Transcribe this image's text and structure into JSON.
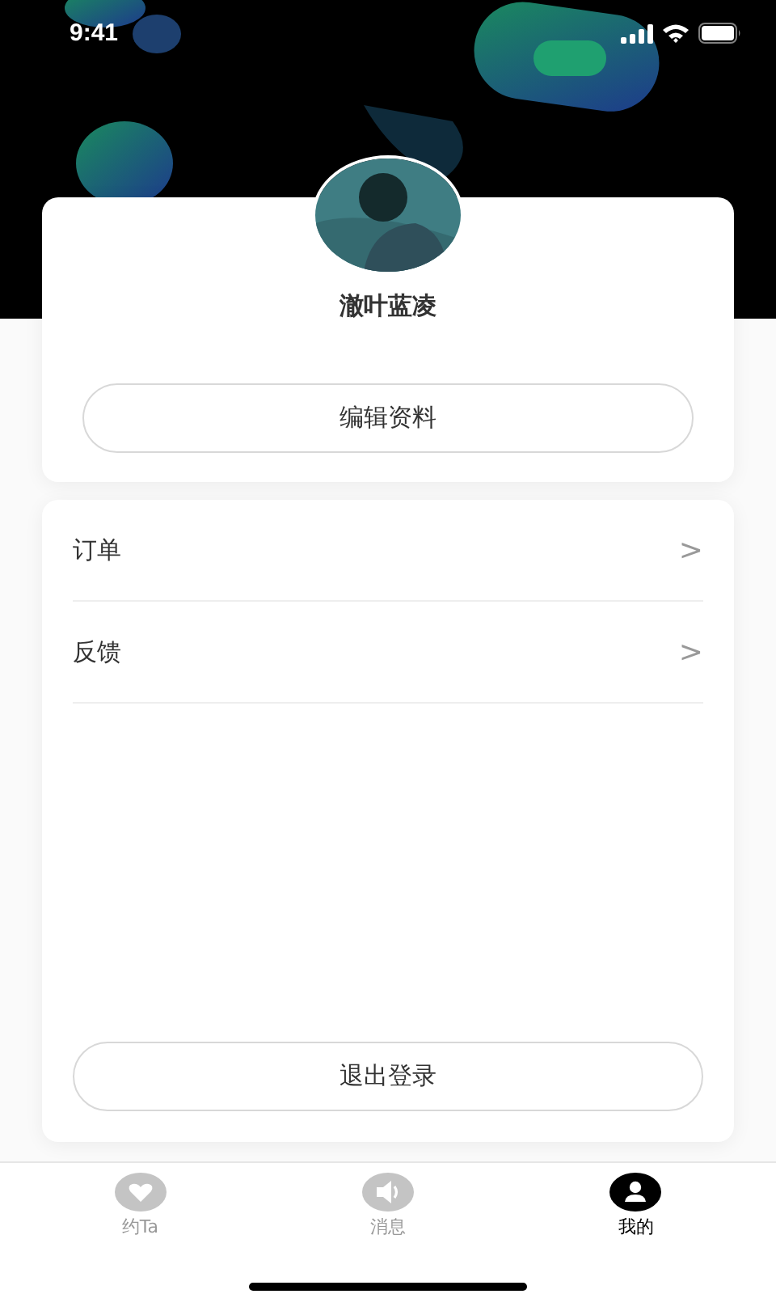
{
  "status_bar": {
    "time": "9:41"
  },
  "profile": {
    "name": "澈叶蓝凌",
    "edit_button": "编辑资料"
  },
  "menu": [
    {
      "label": "订单",
      "chevron": ">"
    },
    {
      "label": "反馈",
      "chevron": ">"
    }
  ],
  "logout_button": "退出登录",
  "tabs": [
    {
      "kind": "heart",
      "label": "约Ta",
      "selected": false
    },
    {
      "kind": "speaker",
      "label": "消息",
      "selected": false
    },
    {
      "kind": "person",
      "label": "我的",
      "selected": true
    }
  ]
}
